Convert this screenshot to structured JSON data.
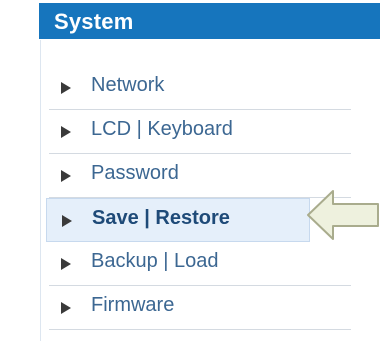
{
  "header": {
    "title": "System",
    "color": "#1675bd"
  },
  "menu": {
    "items": [
      {
        "label": "Network",
        "selected": false
      },
      {
        "label": "LCD | Keyboard",
        "selected": false
      },
      {
        "label": "Password",
        "selected": false
      },
      {
        "label": "Save | Restore",
        "selected": true
      },
      {
        "label": "Backup | Load",
        "selected": false
      },
      {
        "label": "Firmware",
        "selected": false
      }
    ]
  },
  "annotation": {
    "icon": "left-pointing-arrow-icon",
    "color": "#e9edd7"
  }
}
